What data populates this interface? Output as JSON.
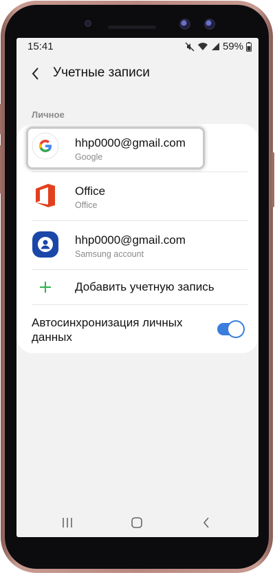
{
  "status_bar": {
    "time": "15:41",
    "battery_percent": "59%",
    "icons": [
      "mute-icon",
      "wifi-icon",
      "signal-icon",
      "battery-icon"
    ]
  },
  "header": {
    "title": "Учетные записи",
    "back_icon": "back-arrow-icon"
  },
  "section_label": "Личное",
  "accounts": [
    {
      "name": "hhp0000@gmail.com",
      "type": "Google",
      "icon": "google-icon"
    },
    {
      "name": "Office",
      "type": "Office",
      "icon": "office-icon"
    },
    {
      "name": "hhp0000@gmail.com",
      "type": "Samsung account",
      "icon": "samsung-account-icon"
    }
  ],
  "add_account": {
    "label": "Добавить учетную запись",
    "icon": "plus-icon"
  },
  "auto_sync": {
    "label": "Автосинхронизация личных данных",
    "enabled": true
  },
  "navbar": {
    "icons": [
      "recent-apps-icon",
      "home-icon",
      "back-icon"
    ]
  },
  "colors": {
    "accent": "#3b7ddd",
    "plus": "#2db34a",
    "office": "#e2401d",
    "samsung": "#1a47a8"
  }
}
